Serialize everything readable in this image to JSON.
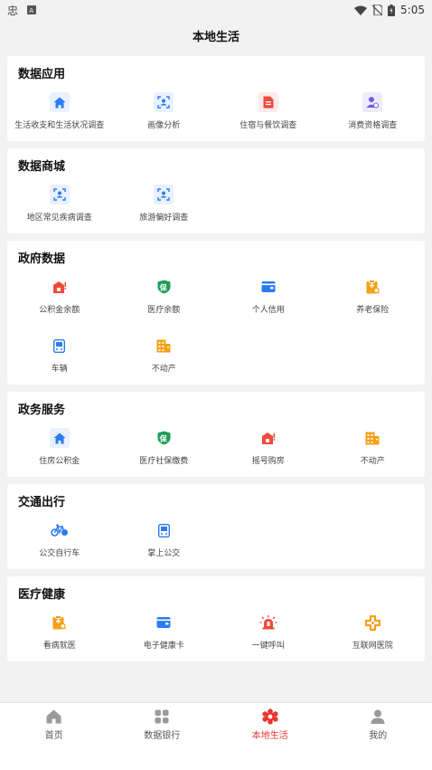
{
  "status": {
    "time": "5:05"
  },
  "title": "本地生活",
  "colors": {
    "blue": "#2b7cf0",
    "green": "#1e9e5a",
    "red": "#ef4a3c",
    "orange": "#f5a01a",
    "purple": "#6a5fe0",
    "active": "#e8362d"
  },
  "sections": [
    {
      "title": "数据应用",
      "items": [
        {
          "label": "生活收支和生活状况调查",
          "icon": "house-icon"
        },
        {
          "label": "画像分析",
          "icon": "face-scan-icon"
        },
        {
          "label": "住宿与餐饮调查",
          "icon": "document-icon"
        },
        {
          "label": "消费资格调查",
          "icon": "person-check-icon"
        }
      ]
    },
    {
      "title": "数据商城",
      "items": [
        {
          "label": "地区常见疾病调查",
          "icon": "face-scan-icon"
        },
        {
          "label": "旅游偏好调查",
          "icon": "face-scan-icon"
        }
      ]
    },
    {
      "title": "政府数据",
      "items": [
        {
          "label": "公积金余额",
          "icon": "house-fund-icon"
        },
        {
          "label": "医疗余额",
          "icon": "shield-bao-icon"
        },
        {
          "label": "个人信用",
          "icon": "wallet-icon"
        },
        {
          "label": "养老保险",
          "icon": "clipboard-icon"
        },
        {
          "label": "车辆",
          "icon": "bus-icon"
        },
        {
          "label": "不动产",
          "icon": "building-icon"
        }
      ]
    },
    {
      "title": "政务服务",
      "items": [
        {
          "label": "住房公积金",
          "icon": "house-icon"
        },
        {
          "label": "医疗社保缴费",
          "icon": "shield-bao-icon"
        },
        {
          "label": "摇号购房",
          "icon": "house-fund-icon"
        },
        {
          "label": "不动产",
          "icon": "building-icon"
        }
      ]
    },
    {
      "title": "交通出行",
      "items": [
        {
          "label": "公交自行车",
          "icon": "bicycle-icon"
        },
        {
          "label": "掌上公交",
          "icon": "bus-icon"
        }
      ]
    },
    {
      "title": "医疗健康",
      "items": [
        {
          "label": "看病就医",
          "icon": "clipboard-icon"
        },
        {
          "label": "电子健康卡",
          "icon": "wallet-icon"
        },
        {
          "label": "一键呼叫",
          "icon": "alarm-icon"
        },
        {
          "label": "互联网医院",
          "icon": "cross-icon"
        }
      ]
    }
  ],
  "tabs": [
    {
      "label": "首页",
      "icon": "home-tab-icon"
    },
    {
      "label": "数据银行",
      "icon": "grid-tab-icon"
    },
    {
      "label": "本地生活",
      "icon": "gear-flower-tab-icon",
      "active": true
    },
    {
      "label": "我的",
      "icon": "person-tab-icon"
    }
  ]
}
